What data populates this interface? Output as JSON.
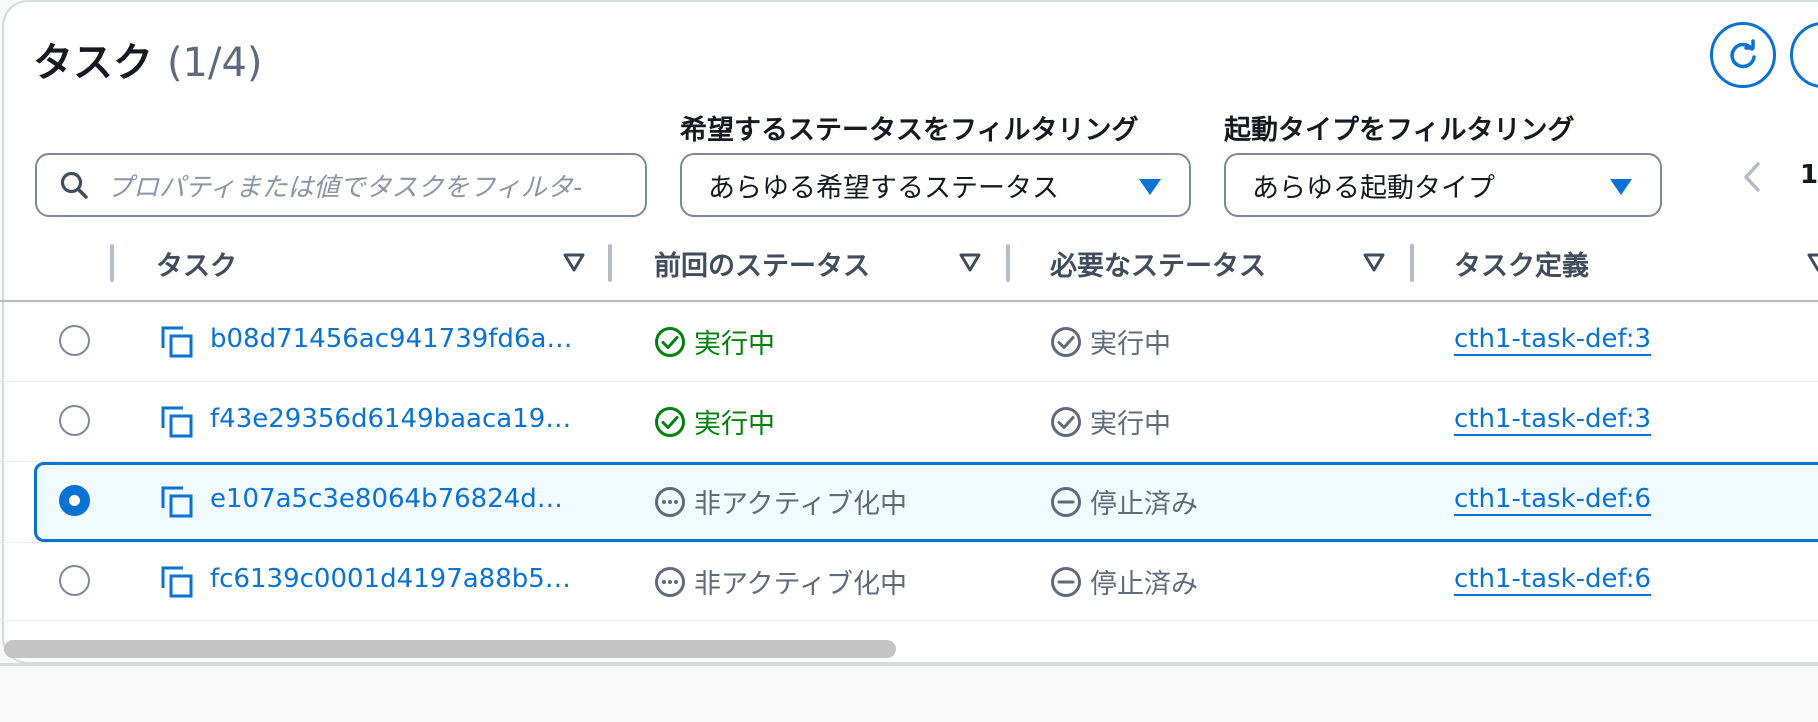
{
  "header": {
    "title": "タスク",
    "count": "(1/4)",
    "refresh_icon": "refresh-icon"
  },
  "filters": {
    "search_placeholder": "プロパティまたは値でタスクをフィルタ-",
    "desired_status_label": "希望するステータスをフィルタリング",
    "desired_status_value": "あらゆる希望するステータス",
    "launch_type_label": "起動タイプをフィルタリング",
    "launch_type_value": "あらゆる起動タイプ"
  },
  "pagination": {
    "current_page": "1"
  },
  "table": {
    "columns": [
      "タスク",
      "前回のステータス",
      "必要なステータス",
      "タスク定義"
    ],
    "rows": [
      {
        "task": "b08d71456ac941739fd6a…",
        "last_status": "実行中",
        "desired_status": "実行中",
        "task_definition": "cth1-task-def:3",
        "selected": false
      },
      {
        "task": "f43e29356d6149baaca19…",
        "last_status": "実行中",
        "desired_status": "実行中",
        "task_definition": "cth1-task-def:3",
        "selected": false
      },
      {
        "task": "e107a5c3e8064b76824d…",
        "last_status": "非アクティブ化中",
        "desired_status": "停止済み",
        "task_definition": "cth1-task-def:6",
        "selected": true
      },
      {
        "task": "fc6139c0001d4197a88b5…",
        "last_status": "非アクティブ化中",
        "desired_status": "停止済み",
        "task_definition": "cth1-task-def:6",
        "selected": false
      }
    ]
  },
  "colors": {
    "accent": "#0972d3",
    "success": "#037f0c",
    "muted": "#5f6b7a"
  }
}
